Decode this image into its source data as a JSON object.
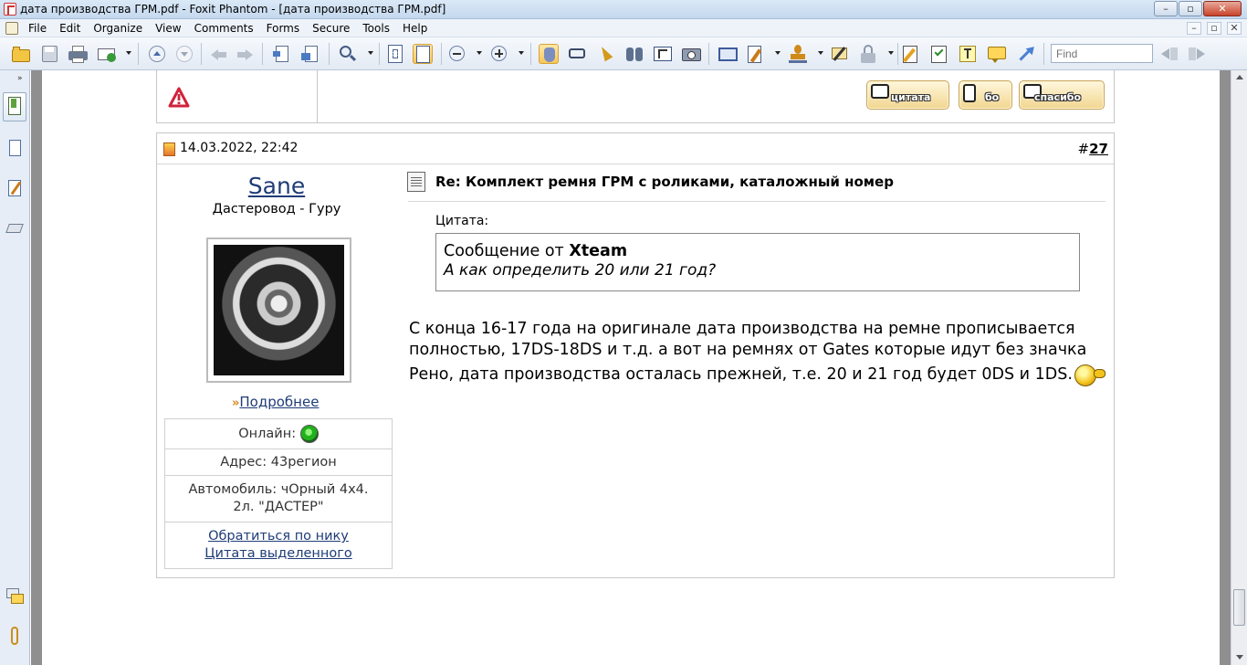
{
  "window": {
    "title": "дата производства ГРМ.pdf - Foxit Phantom - [дата производства ГРМ.pdf]"
  },
  "menu": [
    "File",
    "Edit",
    "Organize",
    "View",
    "Comments",
    "Forms",
    "Secure",
    "Tools",
    "Help"
  ],
  "toolbar": {
    "find_placeholder": "Find"
  },
  "prev_post": {
    "buttons": [
      {
        "label": "цитата",
        "icon": "quote-icon"
      },
      {
        "label": "бо",
        "icon": "plus-icon"
      },
      {
        "label": "спасибо",
        "icon": "thanks-icon"
      }
    ]
  },
  "post": {
    "date": "14.03.2022, 22:42",
    "number_prefix": "#",
    "number": "27",
    "author": {
      "name": "Sane",
      "title": "Дастеровод - Гуру",
      "more_link": "Подробнее",
      "online_label": "Онлайн:",
      "address": "Адрес: 43регион",
      "car_line1": "Автомобиль: чОрный 4х4.",
      "car_line2": "2л. \"ДАСТЕР\"",
      "link_nick": "Обратиться по нику",
      "link_quote": "Цитата выделенного"
    },
    "title": "Re: Комплект ремня ГРМ с роликами, каталожный номер",
    "quote": {
      "label": "Цитата:",
      "prefix": "Сообщение от",
      "author": "Xteam",
      "text": "А как определить 20 или 21 год?"
    },
    "body": "С конца 16-17 года на оригинале дата производства на ремне прописывается полностью, 17DS-18DS и т.д. а вот на ремнях от Gates которые идут без значка Рено, дата производства осталась прежней, т.е. 20 и 21 год будет 0DS и 1DS."
  }
}
